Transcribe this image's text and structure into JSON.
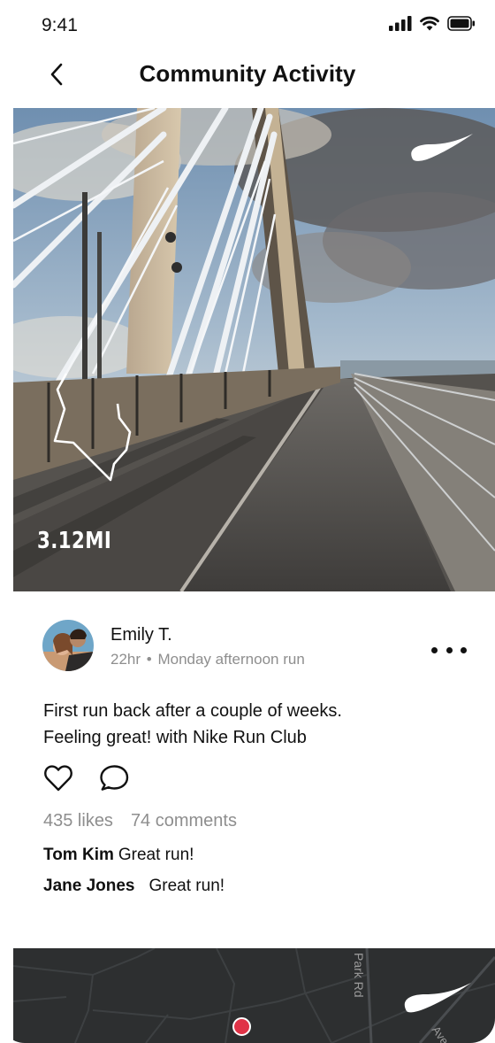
{
  "status_bar": {
    "time": "9:41"
  },
  "header": {
    "title": "Community Activity"
  },
  "hero": {
    "distance": "3.12MI"
  },
  "post": {
    "user_name": "Emily T.",
    "time_ago": "22hr",
    "separator": "•",
    "activity_name": "Monday afternoon run",
    "caption_line1": "First run back after a couple of weeks.",
    "caption_line2": "Feeling great! with Nike Run Club",
    "likes": "435 likes",
    "comments_count": "74 comments"
  },
  "comments": [
    {
      "author": "Tom Kim",
      "text": "Great run!"
    },
    {
      "author": "Jane Jones",
      "text": "Great run!"
    }
  ],
  "map": {
    "road_label": "Park Rd",
    "road_label_2": "Ave"
  },
  "colors": {
    "accent_pin": "#e03347",
    "map_background": "#2d2f30",
    "meta_text": "#8e8e8e"
  },
  "icons": [
    "signal-icon",
    "wifi-icon",
    "battery-icon",
    "back-chevron-icon",
    "nike-swoosh-icon",
    "route-outline",
    "more-options-icon",
    "heart-icon",
    "comment-bubble-icon",
    "map-pin"
  ]
}
